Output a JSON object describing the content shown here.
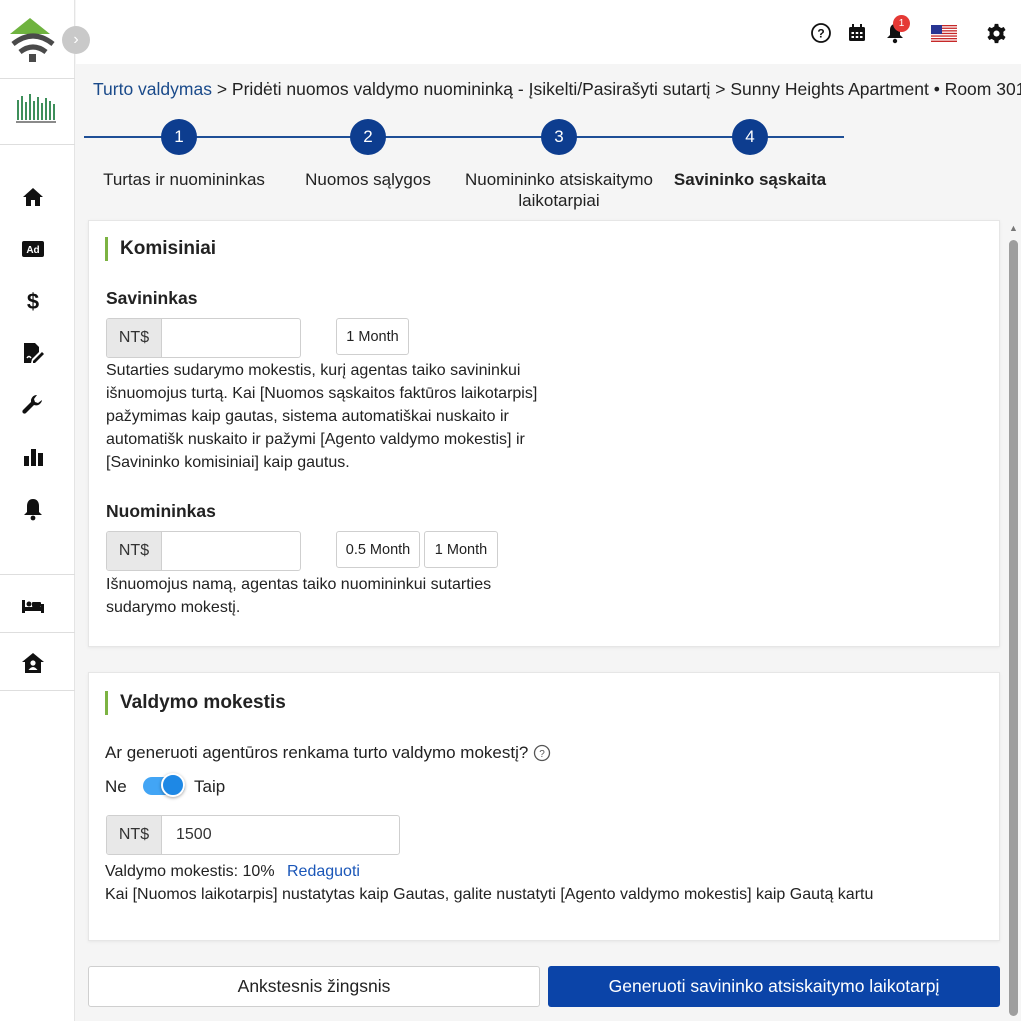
{
  "topbar": {
    "help_icon": "help-circle-icon",
    "calendar_icon": "calendar-icon",
    "bell_icon": "bell-icon",
    "notification_count": "1",
    "flag_icon": "us-flag-icon",
    "settings_icon": "gear-icon"
  },
  "sidebar": {
    "items": [
      {
        "icon": "home-icon"
      },
      {
        "icon": "ad-icon"
      },
      {
        "icon": "dollar-icon"
      },
      {
        "icon": "contract-sign-icon"
      },
      {
        "icon": "wrench-icon"
      },
      {
        "icon": "bar-chart-icon"
      },
      {
        "icon": "bell-icon"
      },
      {
        "icon": "bed-icon"
      },
      {
        "icon": "house-user-icon"
      }
    ]
  },
  "breadcrumb": {
    "root": "Turto valdymas",
    "rest": " > Pridėti nuomos valdymo nuomininką - Įsikelti/Pasirašyti sutartį > Sunny Heights Apartment • Room 301"
  },
  "stepper": {
    "steps": [
      {
        "number": "1",
        "label": "Turtas ir nuomininkas"
      },
      {
        "number": "2",
        "label": "Nuomos sąlygos"
      },
      {
        "number": "3",
        "label": "Nuomininko atsiskaitymo laikotarpiai"
      },
      {
        "number": "4",
        "label": "Savininko sąskaita"
      }
    ],
    "active_step": 4
  },
  "commission": {
    "title": "Komisiniai",
    "owner": {
      "label": "Savininkas",
      "currency": "NT$",
      "value": "",
      "options": [
        "1 Month"
      ],
      "help": "Sutarties sudarymo mokestis, kurį agentas taiko savininkui išnuomojus turtą. Kai [Nuomos sąskaitos faktūros laikotarpis] pažymimas kaip gautas, sistema automatiškai nuskaito ir automatišk nuskaito ir pažymi [Agento valdymo mokestis] ir [Savininko komisiniai] kaip gautus."
    },
    "tenant": {
      "label": "Nuomininkas",
      "currency": "NT$",
      "value": "",
      "options": [
        "0.5 Month",
        "1 Month"
      ],
      "help": "Išnuomojus namą, agentas taiko nuomininkui sutarties sudarymo mokestį."
    }
  },
  "management_fee": {
    "title": "Valdymo mokestis",
    "question": "Ar generuoti agentūros renkama turto valdymo mokestį?",
    "toggle_off_label": "Ne",
    "toggle_on_label": "Taip",
    "toggle_on": true,
    "currency": "NT$",
    "value": "1500",
    "rate_text": "Valdymo mokestis: 10%",
    "edit_label": "Redaguoti",
    "note": "Kai [Nuomos laikotarpis] nustatytas kaip Gautas, galite nustatyti [Agento valdymo mokestis] kaip Gautą kartu"
  },
  "actions": {
    "back_label": "Ankstesnis žingsnis",
    "generate_label": "Generuoti savininko atsiskaitymo laikotarpį"
  },
  "colors": {
    "primary": "#0b44a8",
    "step": "#0d3d8f",
    "accent_green": "#7cb342",
    "toggle": "#1e88e5",
    "badge": "#e53935"
  }
}
